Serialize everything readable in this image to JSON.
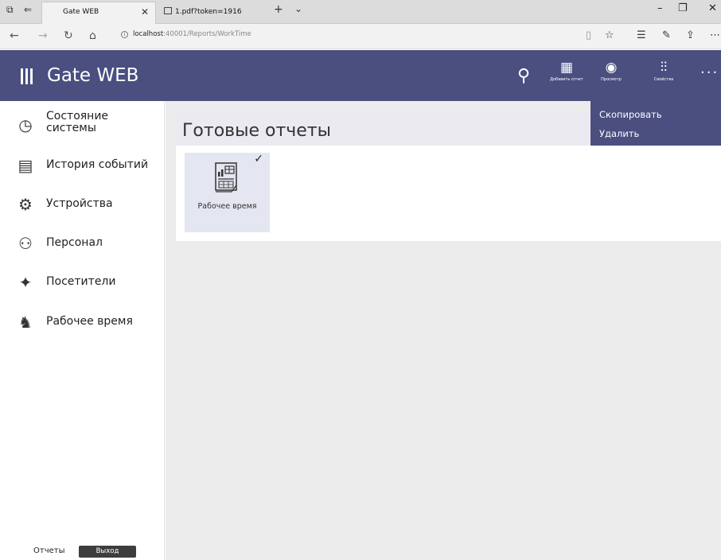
{
  "browser": {
    "tabs": [
      {
        "title": "Gate WEB",
        "active": true
      },
      {
        "title": "1.pdf?token=1916",
        "active": false
      }
    ],
    "url_host": "localhost",
    "url_rest": ":40001/Reports/WorkTime"
  },
  "app": {
    "title": "Gate WEB",
    "accent_color": "#4a4f80",
    "header_actions": [
      {
        "label": "Добавить отчет",
        "icon": "add-report-icon"
      },
      {
        "label": "Просмотр",
        "icon": "eye-icon"
      },
      {
        "label": "Свойства",
        "icon": "sliders-icon"
      }
    ],
    "more_menu": [
      "Скопировать",
      "Удалить"
    ]
  },
  "sidebar": {
    "items": [
      {
        "label": "Состояние системы",
        "icon": "gauge-icon"
      },
      {
        "label": "История событий",
        "icon": "history-icon"
      },
      {
        "label": "Устройства",
        "icon": "gear-icon"
      },
      {
        "label": "Персонал",
        "icon": "staff-icon"
      },
      {
        "label": "Посетители",
        "icon": "walker-icon"
      },
      {
        "label": "Рабочее время",
        "icon": "worktime-icon"
      }
    ],
    "footer_link": "Отчеты",
    "logout_label": "Выход"
  },
  "main": {
    "title": "Готовые отчеты",
    "reports": [
      {
        "label": "Рабочее время",
        "selected": true,
        "icon": "report-doc-icon"
      }
    ]
  }
}
